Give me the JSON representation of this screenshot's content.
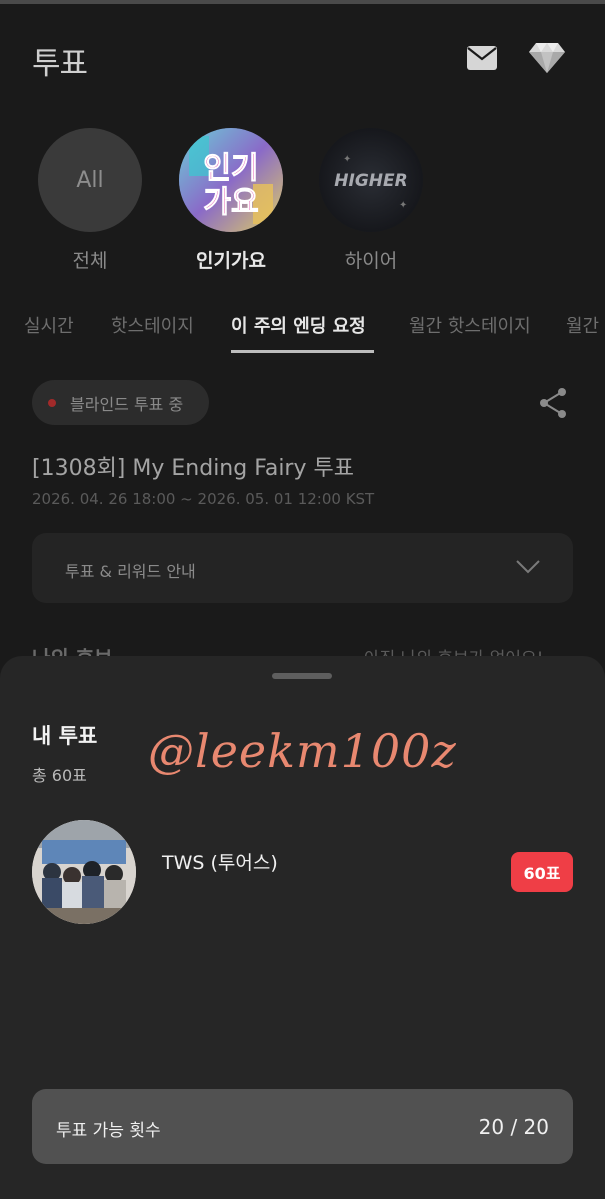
{
  "header": {
    "title": "투표",
    "icons": [
      "mail-icon",
      "diamond-icon"
    ]
  },
  "categories": [
    {
      "label": "전체",
      "circle_text": "All",
      "active": false
    },
    {
      "label": "인기가요",
      "circle_text": "인기가요",
      "active": true
    },
    {
      "label": "하이어",
      "circle_text": "HIGHER",
      "active": false
    }
  ],
  "tabs": [
    {
      "label": "실시간",
      "active": false
    },
    {
      "label": "핫스테이지",
      "active": false
    },
    {
      "label": "이 주의 엔딩 요정",
      "active": true
    },
    {
      "label": "월간 핫스테이지",
      "active": false
    },
    {
      "label": "월간",
      "active": false
    }
  ],
  "vote": {
    "status_badge": "블라인드 투표 중",
    "title": "[1308회] My Ending Fairy 투표",
    "period": "2026. 04. 26 18:00 ~ 2026. 05. 01 12:00 KST",
    "guide_label": "투표 & 리워드 안내",
    "my_candidate_label": "나의 후보",
    "my_candidate_empty": "아직 나의 후보가 없어요!"
  },
  "sheet": {
    "title": "내 투표",
    "total": "총 60표",
    "watermark": "@leekm100z",
    "entries": [
      {
        "artist": "TWS (투어스)",
        "count": "60표"
      }
    ],
    "available_label": "투표 가능 횟수",
    "available_value": "20 / 20"
  },
  "colors": {
    "accent": "#ef3e46",
    "watermark": "#e88870",
    "badge_dot": "#a22a2a"
  }
}
